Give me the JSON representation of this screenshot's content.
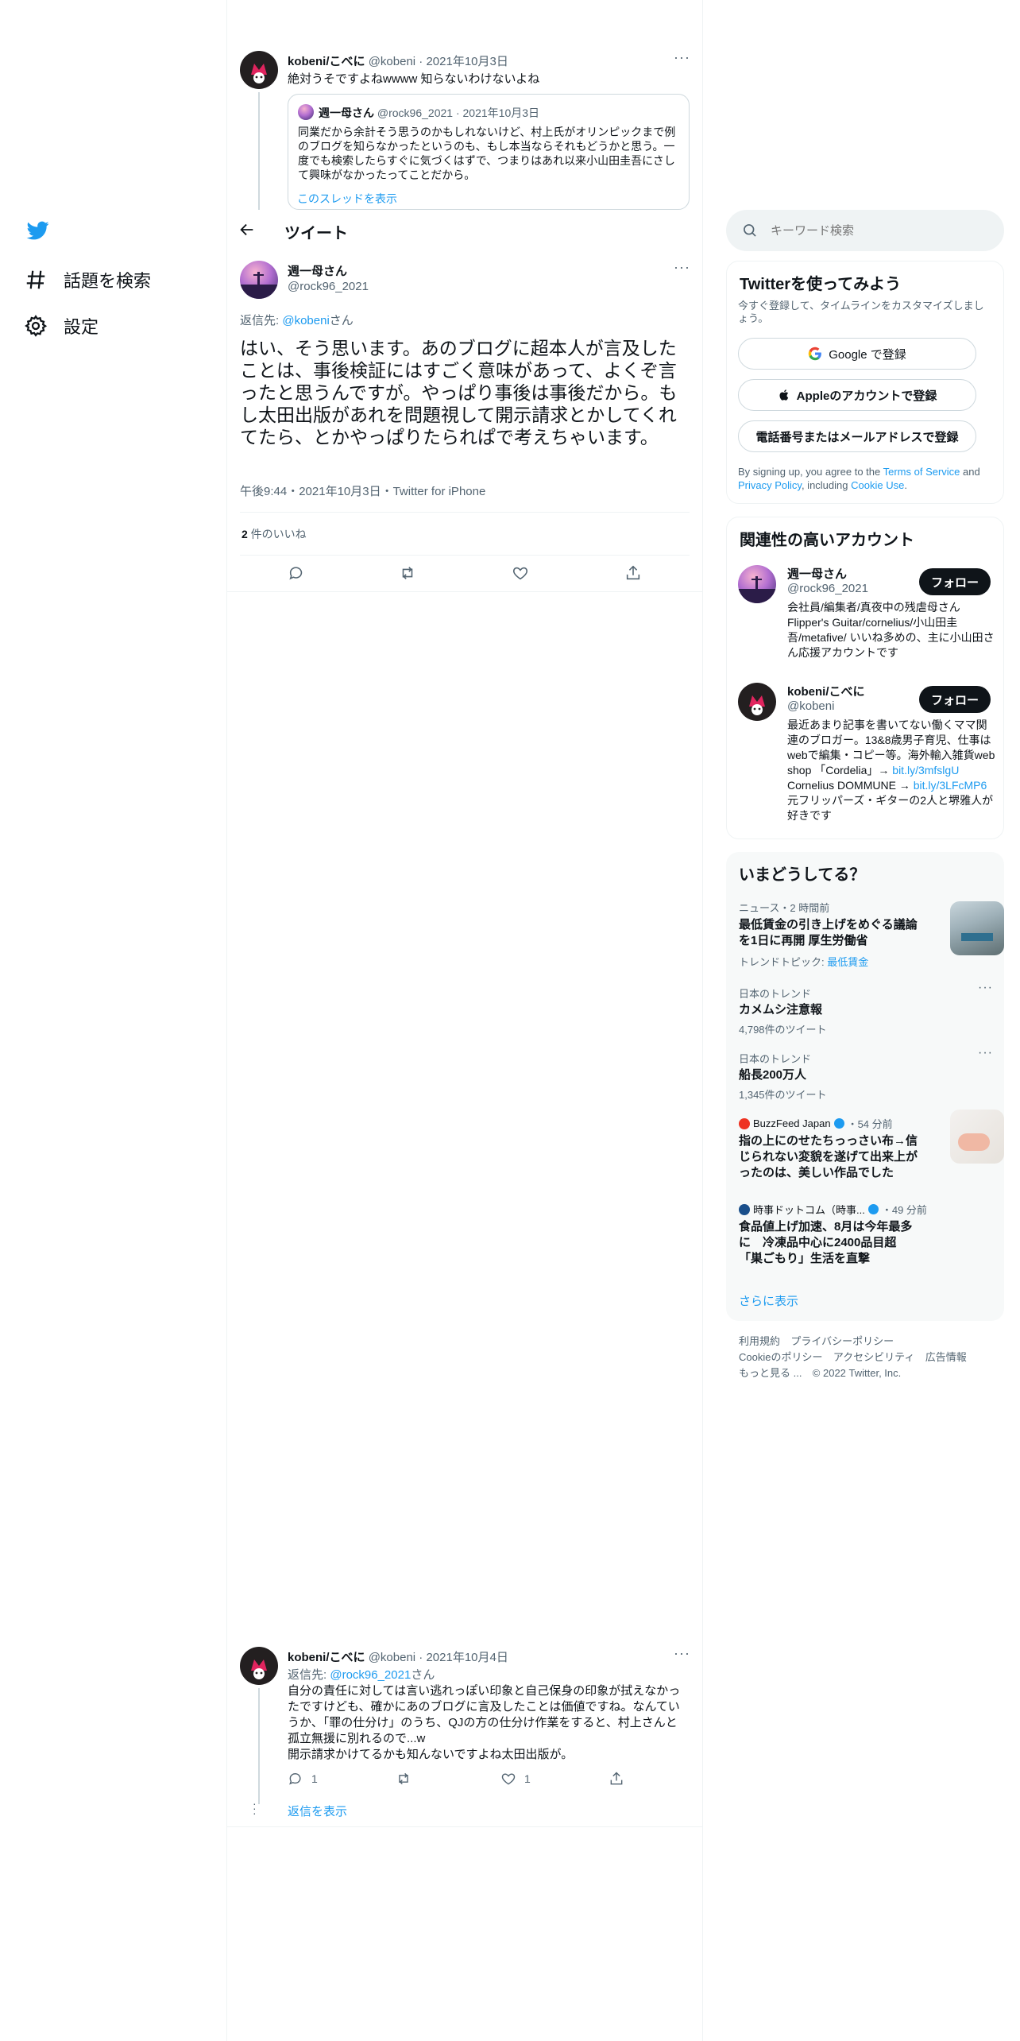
{
  "nav": {
    "explore_label": "話題を検索",
    "settings_label": "設定"
  },
  "header": {
    "title": "ツイート"
  },
  "context_tweet": {
    "author_name": "kobeni/こべに",
    "author_handle": "@kobeni",
    "sep": "·",
    "date": "2021年10月3日",
    "text": "絶対うそですよねwwww 知らないわけないよね",
    "quote": {
      "author_name": "週一母さん",
      "author_handle": "@rock96_2021",
      "sep": "·",
      "date": "2021年10月3日",
      "text": "同業だから余計そう思うのかもしれないけど、村上氏がオリンピックまで例のブログを知らなかったというのも、もし本当ならそれもどうかと思う。一度でも検索したらすぐに気づくはずで、つまりはあれ以来小山田圭吾にさして興味がなかったってことだから。",
      "show_thread": "このスレッドを表示"
    }
  },
  "main_tweet": {
    "author_name": "週一母さん",
    "author_handle": "@rock96_2021",
    "reply_prefix": "返信先: ",
    "reply_to": "@kobeni",
    "reply_suffix": "さん",
    "text": "はい、そう思います。あのブログに超本人が言及したことは、事後検証にはすごく意味があって、よくぞ言ったと思うんですが。やっぱり事後は事後だから。もし太田出版があれを問題視して開示請求とかしてくれてたら、とかやっぱりたられぱで考えちゃいます。",
    "meta": "午後9:44・2021年10月3日・Twitter for iPhone",
    "likes_count": "2",
    "likes_label": " 件のいいね"
  },
  "reply_tweet": {
    "author_name": "kobeni/こべに",
    "author_handle": "@kobeni",
    "sep": "·",
    "date": "2021年10月4日",
    "reply_prefix": "返信先: ",
    "reply_to": "@rock96_2021",
    "reply_suffix": "さん",
    "text_lines": [
      "自分の責任に対しては言い逃れっぽい印象と自己保身の印象が拭えなかったですけども、確かにあのブログに言及したことは価値ですね。なんていうか、「罪の仕分け」のうち、QJの方の仕分け作業をすると、村上さんと孤立無援に別れるので...w",
      "開示請求かけてるかも知んないですよね太田出版が。"
    ],
    "reply_count": "1",
    "like_count": "1",
    "show_replies": "返信を表示"
  },
  "search": {
    "placeholder": "キーワード検索"
  },
  "signup": {
    "title": "Twitterを使ってみよう",
    "subtitle": "今すぐ登録して、タイムラインをカスタマイズしましょう。",
    "google_button": "Google で登録",
    "apple_button": "Appleのアカウントで登録",
    "phone_button": "電話番号またはメールアドレスで登録",
    "terms_prefix": "By signing up, you agree to the ",
    "terms_link": "Terms of Service",
    "terms_and": " and ",
    "privacy_link": "Privacy Policy",
    "terms_including": ", including ",
    "cookie_link": "Cookie Use",
    "terms_end": "."
  },
  "related": {
    "title": "関連性の高いアカウント",
    "accounts": [
      {
        "name": "週一母さん",
        "handle": "@rock96_2021",
        "follow": "フォロー",
        "bio": "会社員/編集者/真夜中の残虐母さん Flipper's Guitar/cornelius/小山田圭吾/metafive/ いいね多めの、主に小山田さん応援アカウントです"
      },
      {
        "name": "kobeni/こべに",
        "handle": "@kobeni",
        "follow": "フォロー",
        "bio_a": "最近あまり記事を書いてない働くママ関連のブロガー。13&8歳男子育児、仕事はwebで編集・コピー等。海外輸入雑貨web shop 「Cordelia」→ ",
        "bio_link1": "bit.ly/3mfslgU",
        "bio_b": " Cornelius DOMMUNE → ",
        "bio_link2": "bit.ly/3LFcMP6",
        "bio_c": " 元フリッパーズ・ギターの2人と堺雅人が好きです"
      }
    ]
  },
  "trends": {
    "title": "いまどうしてる？",
    "items": [
      {
        "meta": "ニュース・2 時間前",
        "title": "最低賃金の引き上げをめぐる議論を1日に再開 厚生労働省",
        "topic_prefix": "トレンドトピック: ",
        "topic": "最低賃金"
      },
      {
        "meta": "日本のトレンド",
        "title": "カメムシ注意報",
        "count": "4,798件のツイート"
      },
      {
        "meta": "日本のトレンド",
        "title": "船長200万人",
        "count": "1,345件のツイート"
      },
      {
        "source": "BuzzFeed Japan",
        "time": "・54 分前",
        "title": "指の上にのせたちっっさい布→信じられない変貌を遂げて出来上がったのは、美しい作品でした"
      },
      {
        "source": "時事ドットコム（時事...",
        "time": "・49 分前",
        "title": "食品値上げ加速、8月は今年最多に　冷凍品中心に2400品目超　「巣ごもり」生活を直撃"
      }
    ],
    "show_more": "さらに表示"
  },
  "footer": {
    "links": [
      "利用規約",
      "プライバシーポリシー",
      "Cookieのポリシー",
      "アクセシビリティ",
      "広告情報",
      "もっと見る ..."
    ],
    "copyright": "© 2022 Twitter, Inc."
  },
  "colors": {
    "accent": "#1d9bf0",
    "text": "#0f1419",
    "muted": "#536471",
    "border": "#eff3f4"
  }
}
